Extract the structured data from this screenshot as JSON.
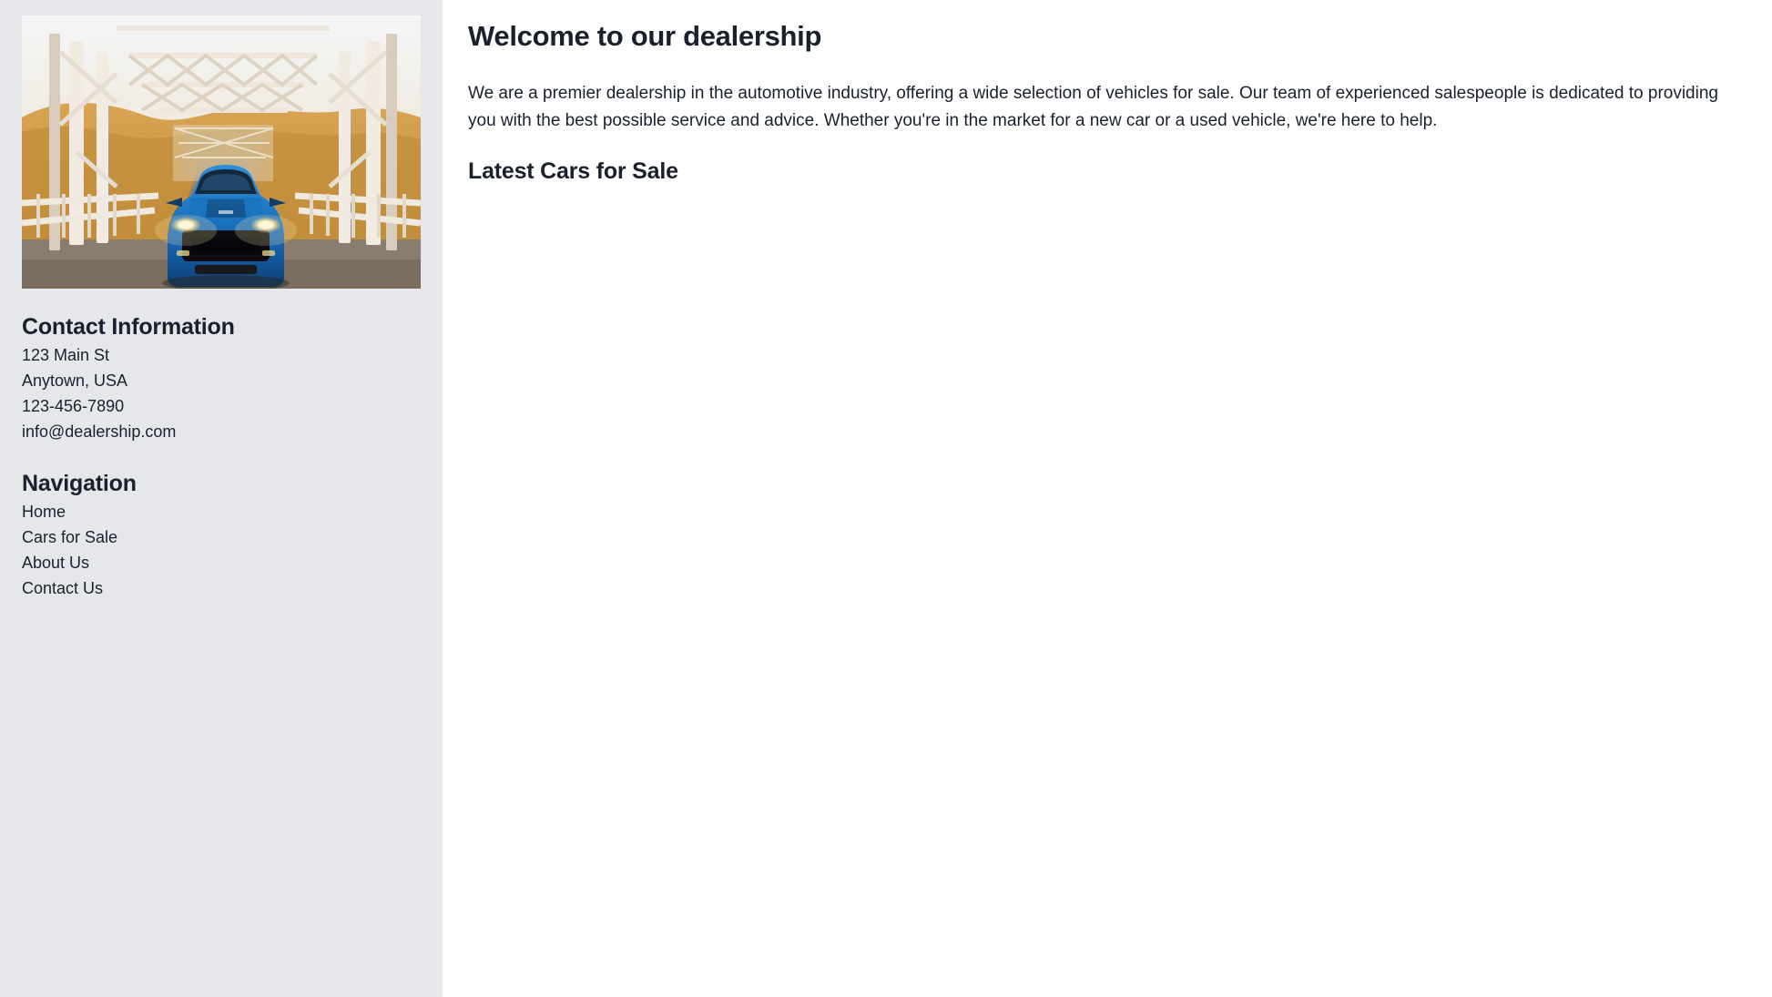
{
  "sidebar": {
    "hero_image": {
      "alt": "Blue sports car driving across a steel truss bridge at sunset",
      "icon": "car-on-bridge-photo"
    },
    "contact": {
      "heading": "Contact Information",
      "lines": [
        "123 Main St",
        "Anytown, USA",
        "123-456-7890",
        "info@dealership.com"
      ]
    },
    "navigation": {
      "heading": "Navigation",
      "items": [
        {
          "label": "Home"
        },
        {
          "label": "Cars for Sale"
        },
        {
          "label": "About Us"
        },
        {
          "label": "Contact Us"
        }
      ]
    }
  },
  "main": {
    "title": "Welcome to our dealership",
    "intro": "We are a premier dealership in the automotive industry, offering a wide selection of vehicles for sale. Our team of experienced salespeople is dedicated to providing you with the best possible service and advice. Whether you're in the market for a new car or a used vehicle, we're here to help.",
    "latest_heading": "Latest Cars for Sale",
    "latest_cars": []
  },
  "colors": {
    "sidebar_background": "#e5e7eb",
    "main_background": "#ffffff",
    "text": "#1a202c"
  }
}
